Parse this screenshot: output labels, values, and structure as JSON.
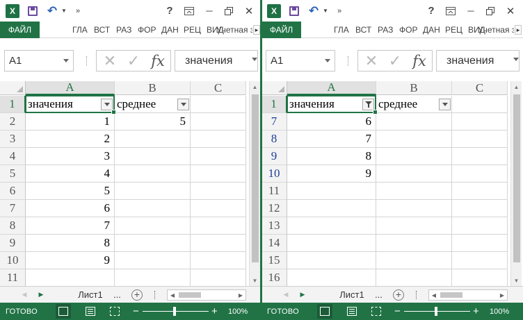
{
  "windows": [
    {
      "id": "left",
      "titlebar": {
        "app_icon": "excel-icon",
        "help": "?",
        "minimize": "─",
        "close": "✕"
      },
      "ribbon_tabs": [
        {
          "label": "ФАЙЛ",
          "active": true
        },
        {
          "label": "ГЛА"
        },
        {
          "label": "ВСТ"
        },
        {
          "label": "РАЗ"
        },
        {
          "label": "ФОР"
        },
        {
          "label": "ДАН"
        },
        {
          "label": "РЕЦ"
        },
        {
          "label": "ВИД"
        },
        {
          "label": "Учетная з"
        }
      ],
      "name_box": "A1",
      "formula_value": "значения",
      "columns": [
        "A",
        "B",
        "C"
      ],
      "active_column": "A",
      "rows": [
        {
          "num": "1",
          "a": "значения",
          "b": "среднее",
          "filtered": false
        },
        {
          "num": "2",
          "a": "1",
          "b": "5",
          "filtered": false
        },
        {
          "num": "3",
          "a": "2",
          "b": "",
          "filtered": false
        },
        {
          "num": "4",
          "a": "3",
          "b": "",
          "filtered": false
        },
        {
          "num": "5",
          "a": "4",
          "b": "",
          "filtered": false
        },
        {
          "num": "6",
          "a": "5",
          "b": "",
          "filtered": false
        },
        {
          "num": "7",
          "a": "6",
          "b": "",
          "filtered": false
        },
        {
          "num": "8",
          "a": "7",
          "b": "",
          "filtered": false
        },
        {
          "num": "9",
          "a": "8",
          "b": "",
          "filtered": false
        },
        {
          "num": "10",
          "a": "9",
          "b": "",
          "filtered": false
        },
        {
          "num": "11",
          "a": "",
          "b": "",
          "filtered": false
        }
      ],
      "filter_a_active": false,
      "sheet_tab": "Лист1",
      "sheet_more": "...",
      "status_ready": "ГОТОВО",
      "zoom": "100%"
    },
    {
      "id": "right",
      "titlebar": {
        "app_icon": "excel-icon",
        "help": "?",
        "minimize": "─",
        "close": "✕"
      },
      "ribbon_tabs": [
        {
          "label": "ФАЙЛ",
          "active": true
        },
        {
          "label": "ГЛА"
        },
        {
          "label": "ВСТ"
        },
        {
          "label": "РАЗ"
        },
        {
          "label": "ФОР"
        },
        {
          "label": "ДАН"
        },
        {
          "label": "РЕЦ"
        },
        {
          "label": "ВИД"
        },
        {
          "label": "Учетная з"
        }
      ],
      "name_box": "A1",
      "formula_value": "значения",
      "columns": [
        "A",
        "B",
        "C"
      ],
      "active_column": "A",
      "rows": [
        {
          "num": "1",
          "a": "значения",
          "b": "среднее",
          "filtered": false
        },
        {
          "num": "7",
          "a": "6",
          "b": "",
          "filtered": true
        },
        {
          "num": "8",
          "a": "7",
          "b": "",
          "filtered": true
        },
        {
          "num": "9",
          "a": "8",
          "b": "",
          "filtered": true
        },
        {
          "num": "10",
          "a": "9",
          "b": "",
          "filtered": true
        },
        {
          "num": "11",
          "a": "",
          "b": "",
          "filtered": false
        },
        {
          "num": "12",
          "a": "",
          "b": "",
          "filtered": false
        },
        {
          "num": "13",
          "a": "",
          "b": "",
          "filtered": false
        },
        {
          "num": "14",
          "a": "",
          "b": "",
          "filtered": false
        },
        {
          "num": "15",
          "a": "",
          "b": "",
          "filtered": false
        },
        {
          "num": "16",
          "a": "",
          "b": "",
          "filtered": false
        }
      ],
      "filter_a_active": true,
      "sheet_tab": "Лист1",
      "sheet_more": "...",
      "status_ready": "ГОТОВО",
      "zoom": "100%"
    }
  ],
  "colors": {
    "accent": "#217346",
    "filtered_row_number": "#1f3d99"
  }
}
